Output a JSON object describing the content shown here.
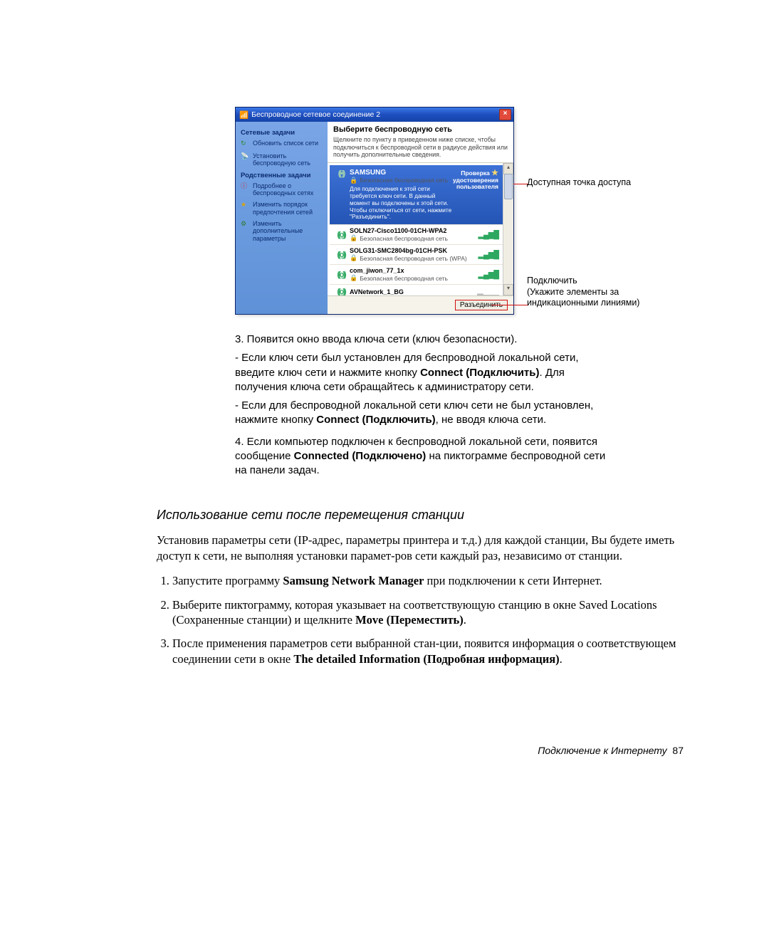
{
  "window": {
    "title": "Беспроводное сетевое соединение 2",
    "sidebar": {
      "group1_title": "Сетевые задачи",
      "link1": "Обновить список сети",
      "link2": "Установить беспроводную сеть",
      "group2_title": "Родственные задачи",
      "link3": "Подробнее о беспроводных сетях",
      "link4": "Изменить порядок предпочтения сетей",
      "link5": "Изменить дополнительные параметры"
    },
    "main": {
      "heading": "Выберите беспроводную сеть",
      "subtext": "Щелкните по пункту в приведенном ниже списке, чтобы подключиться к беспроводной сети в радиусе действия или получить дополнительные сведения.",
      "selected": {
        "name": "SAMSUNG",
        "security": "Безопасная беспроводная сеть",
        "badge1": "Проверка",
        "badge2": "удостоверения",
        "badge3": "пользователя",
        "msg": "Для подключения к этой сети требуется ключ сети. В данный момент вы подключены к этой сети. Чтобы отключиться от сети, нажмите \"Разъединить\"."
      },
      "items": [
        {
          "name": "SOLN27-Cisco1100-01CH-WPA2",
          "sec": "Безопасная беспроводная сеть"
        },
        {
          "name": "SOLG31-SMC2804bg-01CH-PSK",
          "sec": "Безопасная беспроводная сеть (WPA)"
        },
        {
          "name": "com_jiwon_77_1x",
          "sec": "Безопасная беспроводная сеть"
        },
        {
          "name": "AVNetwork_1_BG",
          "sec": ""
        }
      ],
      "disconnect_btn": "Разъединить"
    }
  },
  "annotations": {
    "a1": "Доступная точка доступа",
    "a2": "Подключить (Укажите элементы за индикационными линиями)"
  },
  "body": {
    "p3_lead": "3. Появится окно ввода ключа сети (ключ безопасности).",
    "p3_b1a": "- Если ключ сети был установлен для беспроводной локальной сети, введите ключ сети и нажмите кнопку ",
    "p3_b1_bold": "Connect (Подключить)",
    "p3_b1b": ". Для получения ключа сети обращайтесь к администратору сети.",
    "p3_b2a": "- Если для беспроводной локальной сети ключ сети не был установлен, нажмите кнопку ",
    "p3_b2_bold": "Connect (Подключить)",
    "p3_b2b": ", не вводя ключа сети.",
    "p4a": "4. Если компьютер подключен к беспроводной локальной сети, появится сообщение ",
    "p4_bold": "Connected (Подключено)",
    "p4b": " на пиктограмме беспроводной сети на панели задач."
  },
  "section2": {
    "heading": "Использование сети после перемещения станции",
    "intro": "Установив параметры сети (IP-адрес, параметры принтера и т.д.) для каждой станции, Вы будете иметь доступ к сети, не выполняя установки парамет-ров сети каждый раз, независимо от станции.",
    "step1a": "Запустите программу ",
    "step1_bold": "Samsung Network Manager",
    "step1b": " при подключении к сети Интернет.",
    "step2a": "Выберите пиктограмму, которая указывает на соответствующую станцию в окне Saved Locations (Сохраненные станции) и щелкните ",
    "step2_bold": "Move (Переместить)",
    "step2b": ".",
    "step3a": "После применения параметров сети выбранной стан-ции, появится информация о соответствующем соединении сети в окне ",
    "step3_bold": "The detailed Information (Подробная информация)",
    "step3b": "."
  },
  "footer": {
    "text": "Подключение к Интернету",
    "page": "87"
  }
}
